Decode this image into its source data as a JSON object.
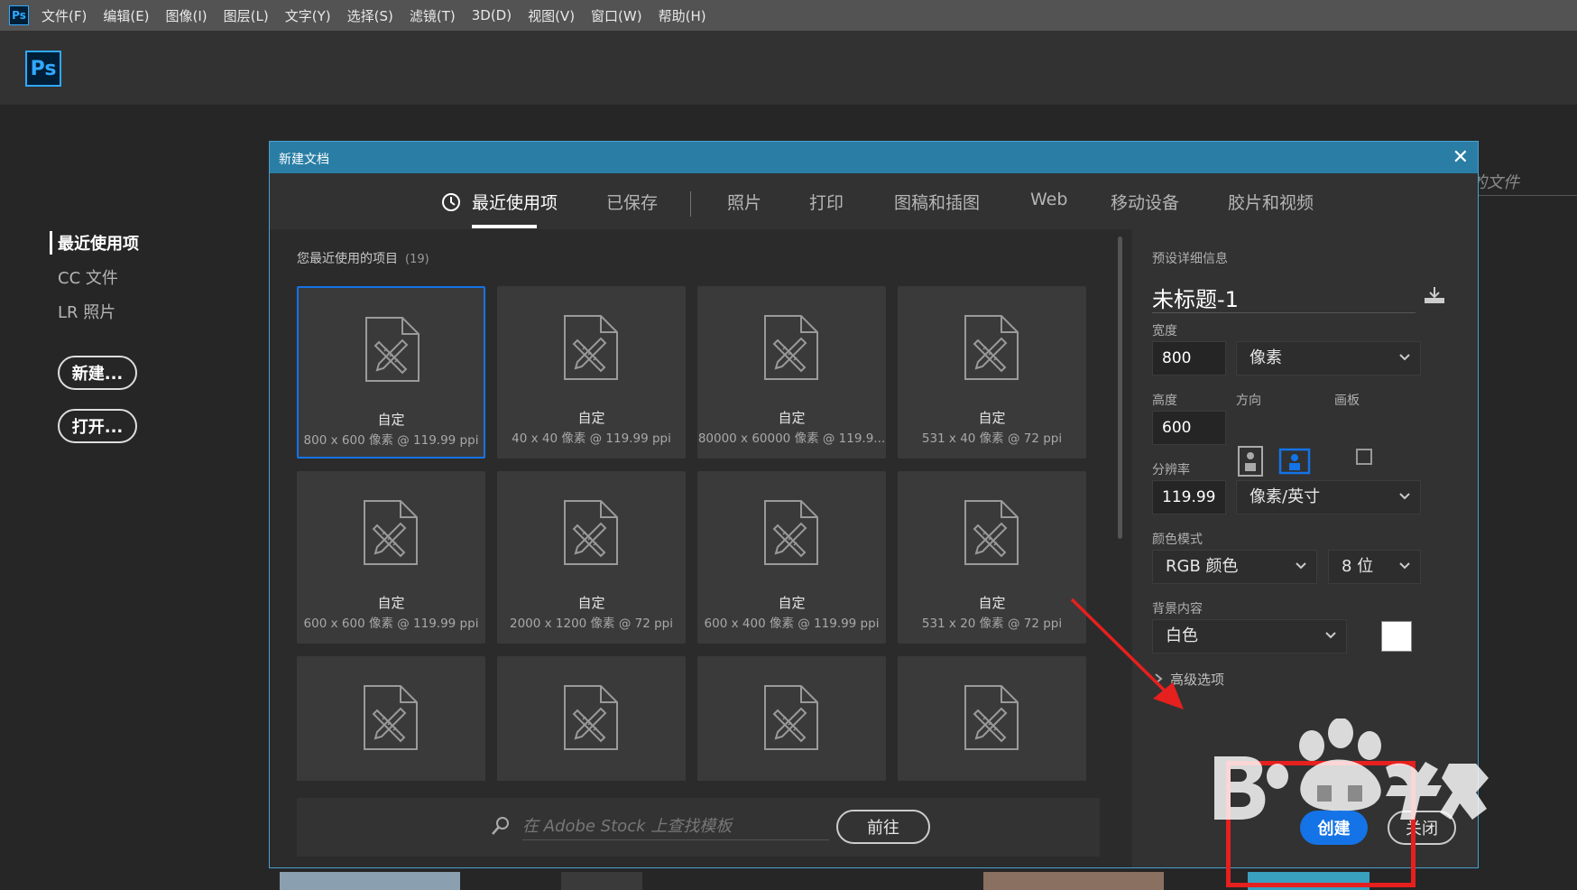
{
  "app": {
    "logo": "Ps",
    "menu": [
      "文件(F)",
      "编辑(E)",
      "图像(I)",
      "图层(L)",
      "文字(Y)",
      "选择(S)",
      "滤镜(T)",
      "3D(D)",
      "视图(V)",
      "窗口(W)",
      "帮助(H)"
    ]
  },
  "home": {
    "nav": [
      "最近使用项",
      "CC 文件",
      "LR 照片"
    ],
    "new_button": "新建...",
    "open_button": "打开...",
    "recent_files_label": "的文件"
  },
  "dialog": {
    "title": "新建文档",
    "close": "✕",
    "tabs": [
      "最近使用项",
      "已保存",
      "照片",
      "打印",
      "图稿和插图",
      "Web",
      "移动设备",
      "胶片和视频"
    ],
    "recent": {
      "title": "您最近使用的项目",
      "count": "(19)",
      "items": [
        {
          "name": "自定",
          "size": "800 x 600 像素 @ 119.99 ppi"
        },
        {
          "name": "自定",
          "size": "40 x 40 像素 @ 119.99 ppi"
        },
        {
          "name": "自定",
          "size": "80000 x 60000 像素 @ 119.9..."
        },
        {
          "name": "自定",
          "size": "531 x 40 像素 @ 72 ppi"
        },
        {
          "name": "自定",
          "size": "600 x 600 像素 @ 119.99 ppi"
        },
        {
          "name": "自定",
          "size": "2000 x 1200 像素 @ 72 ppi"
        },
        {
          "name": "自定",
          "size": "600 x 400 像素 @ 119.99 ppi"
        },
        {
          "name": "自定",
          "size": "531 x 20 像素 @ 72 ppi"
        },
        {
          "name": "",
          "size": ""
        },
        {
          "name": "",
          "size": ""
        },
        {
          "name": "",
          "size": ""
        },
        {
          "name": "",
          "size": ""
        }
      ]
    },
    "search": {
      "placeholder": "在 Adobe Stock 上查找模板",
      "go_button": "前往"
    },
    "preset": {
      "header": "预设详细信息",
      "doc_name": "未标题-1",
      "width_label": "宽度",
      "width": "800",
      "width_unit": "像素",
      "height_label": "高度",
      "height": "600",
      "orientation_label": "方向",
      "artboard_label": "画板",
      "resolution_label": "分辨率",
      "resolution": "119.99",
      "resolution_unit": "像素/英寸",
      "color_mode_label": "颜色模式",
      "color_mode": "RGB 颜色",
      "bit_depth": "8 位",
      "background_label": "背景内容",
      "background": "白色",
      "advanced": "高级选项",
      "create_button": "创建",
      "close_button": "关闭"
    }
  },
  "colors": {
    "accent": "#1473e6",
    "titlebar": "#2a7ea5",
    "annotation": "#e5201e"
  }
}
